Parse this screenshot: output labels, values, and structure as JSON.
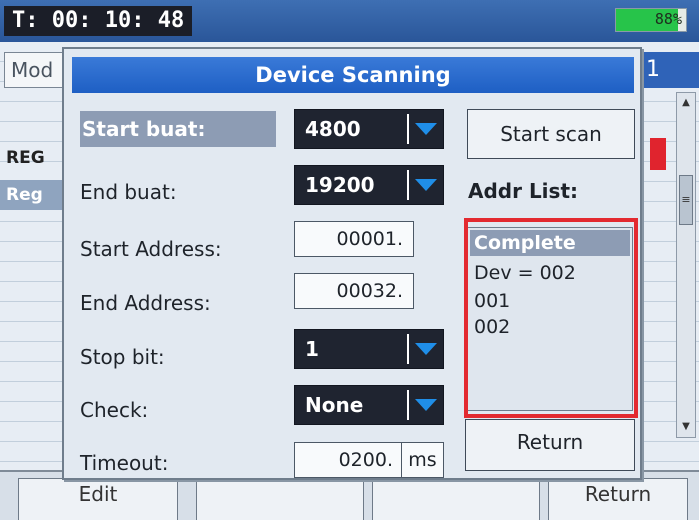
{
  "status_bar": {
    "timer": "T: 00: 10: 48",
    "battery": "88%",
    "battery_level": 0.88,
    "battery_color": "#27c44a"
  },
  "background": {
    "mode_tab": "Mod",
    "right_header": "1",
    "row_reg_1": "REG",
    "row_reg_2": "Reg"
  },
  "bottom_bar": {
    "edit_label": "Edit",
    "return_label": "Return"
  },
  "dialog": {
    "title": "Device Scanning",
    "title_color": "#1e5fc4",
    "start_baud": {
      "label": "Start buat:",
      "value": "4800"
    },
    "end_baud": {
      "label": "End buat:",
      "value": "19200"
    },
    "start_address": {
      "label": "Start Address:",
      "value": "00001."
    },
    "end_address": {
      "label": "End Address:",
      "value": "00032."
    },
    "stop_bit": {
      "label": "Stop bit:",
      "value": "1"
    },
    "check": {
      "label": "Check:",
      "value": "None"
    },
    "timeout": {
      "label": "Timeout:",
      "value": "0200.",
      "unit": "ms"
    },
    "start_scan_label": "Start scan",
    "addr_list_label": "Addr List:",
    "addr_list": {
      "status": "Complete",
      "items": [
        "Dev = 002",
        "001",
        "002"
      ]
    },
    "return_label": "Return"
  },
  "annotation_color": "#e32a30"
}
